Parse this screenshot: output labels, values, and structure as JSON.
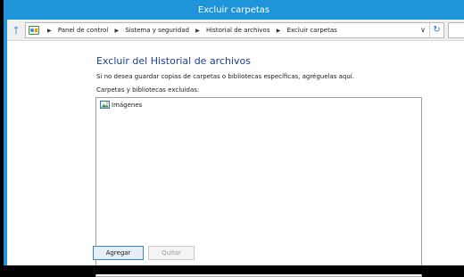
{
  "window": {
    "title": "Excluir carpetas"
  },
  "navigation": {
    "breadcrumbs": [
      "Panel de control",
      "Sistema y seguridad",
      "Historial de archivos",
      "Excluir carpetas"
    ],
    "dropdown_glyph": "∨",
    "refresh_glyph": "↻"
  },
  "content": {
    "heading": "Excluir del Historial de archivos",
    "description": "Si no desea guardar copias de carpetas o bibliotecas específicas, agréguelas aquí.",
    "list_label": "Carpetas y bibliotecas excluidas:",
    "items": [
      {
        "label": "Imágenes",
        "icon": "pictures-library-icon"
      }
    ]
  },
  "buttons": {
    "add": "Agregar",
    "remove": "Quitar"
  },
  "colors": {
    "titlebar": "#1f95d9",
    "heading": "#1e3f8c",
    "accent_border": "#3a7fd0"
  }
}
